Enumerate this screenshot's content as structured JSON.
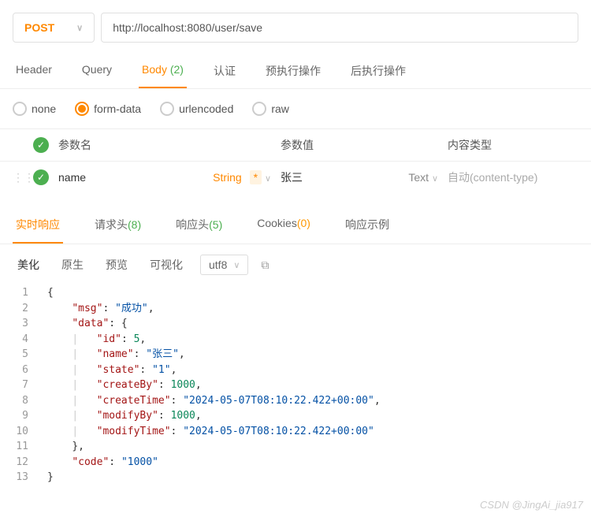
{
  "request": {
    "method": "POST",
    "url": "http://localhost:8080/user/save"
  },
  "tabs": {
    "header": "Header",
    "query": "Query",
    "body": "Body",
    "body_count": "(2)",
    "auth": "认证",
    "pre": "预执行操作",
    "post": "后执行操作"
  },
  "body_type": {
    "none": "none",
    "form": "form-data",
    "urlencoded": "urlencoded",
    "raw": "raw"
  },
  "params_header": {
    "name": "参数名",
    "value": "参数值",
    "content_type": "内容类型"
  },
  "param_row": {
    "name": "name",
    "dtype": "String",
    "star": "*",
    "value": "张三",
    "vtype": "Text",
    "content_type": "自动(content-type)"
  },
  "resp_tabs": {
    "realtime": "实时响应",
    "req_headers": "请求头",
    "req_headers_cnt": "(8)",
    "resp_headers": "响应头",
    "resp_headers_cnt": "(5)",
    "cookies": "Cookies",
    "cookies_cnt": "(0)",
    "example": "响应示例"
  },
  "toolbar": {
    "beautify": "美化",
    "raw": "原生",
    "preview": "预览",
    "visualize": "可视化",
    "encoding": "utf8"
  },
  "json_kv": {
    "msg_k": "\"msg\"",
    "msg_v": "\"成功\"",
    "data_k": "\"data\"",
    "id_k": "\"id\"",
    "id_v": "5",
    "name_k": "\"name\"",
    "name_v": "\"张三\"",
    "state_k": "\"state\"",
    "state_v": "\"1\"",
    "createBy_k": "\"createBy\"",
    "createBy_v": "1000",
    "createTime_k": "\"createTime\"",
    "createTime_v": "\"2024-05-07T08:10:22.422+00:00\"",
    "modifyBy_k": "\"modifyBy\"",
    "modifyBy_v": "1000",
    "modifyTime_k": "\"modifyTime\"",
    "modifyTime_v": "\"2024-05-07T08:10:22.422+00:00\"",
    "code_k": "\"code\"",
    "code_v": "\"1000\""
  },
  "watermark": "CSDN @JingAi_jia917"
}
